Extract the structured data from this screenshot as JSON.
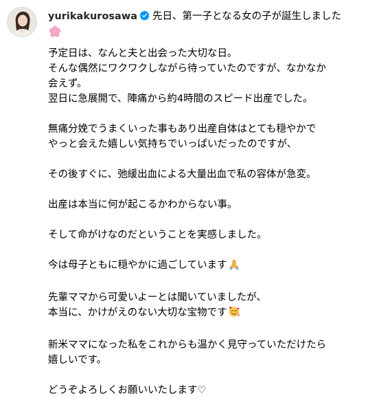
{
  "post": {
    "username": "yurikakurosawa",
    "verified": true,
    "avatar_icon": "profile-avatar",
    "headline": "先日、第一子となる女の子が誕生しました",
    "headline_emoji": "cherry-blossom-emoji",
    "paragraphs": [
      {
        "lines": [
          "予定日は、なんと夫と出会った大切な日。",
          "そんな偶然にワクワクしながら待っていたのですが、なかなか",
          "会えず。",
          "翌日に急展開で、陣痛から約4時間のスピード出産でした。"
        ]
      },
      {
        "lines": [
          "無痛分娩でうまくいった事もあり出産自体はとても穏やかで",
          "やっと会えた嬉しい気持ちでいっぱいだったのですが、"
        ]
      },
      {
        "lines": [
          "その後すぐに、弛緩出血による大量出血で私の容体が急変。"
        ]
      },
      {
        "lines": [
          "出産は本当に何が起こるかわからない事。"
        ]
      },
      {
        "lines": [
          "そして命がけなのだということを実感しました。"
        ]
      },
      {
        "lines": [
          "今は母子ともに穏やかに過ごしています"
        ],
        "emoji": "folded-hands-emoji"
      },
      {
        "lines": [
          "先輩ママから可愛いよーとは聞いていましたが、",
          "本当に、かけがえのない大切な宝物です"
        ],
        "emoji": "smiling-face-with-hearts-emoji"
      },
      {
        "lines": [
          "新米ママになった私をこれからも温かく見守っていただけたら",
          "嬉しいです。"
        ]
      },
      {
        "lines": [
          "どうぞよろしくお願いいたします♡"
        ]
      }
    ]
  },
  "colors": {
    "verified_badge": "#0095f6",
    "username": "#262626",
    "text": "#000000",
    "blossom": "#f7a8c8",
    "avatar_bg": "#e9e4dc"
  }
}
